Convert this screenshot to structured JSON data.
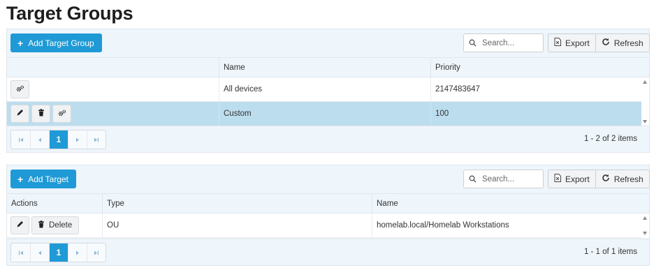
{
  "page": {
    "title": "Target Groups"
  },
  "groups_grid": {
    "add_button": "Add Target Group",
    "search_placeholder": "Search...",
    "export_label": "Export",
    "refresh_label": "Refresh",
    "columns": [
      "",
      "Name",
      "Priority"
    ],
    "rows": [
      {
        "name": "All devices",
        "priority": "2147483647"
      },
      {
        "name": "Custom",
        "priority": "100"
      }
    ],
    "pager": {
      "current_page": "1",
      "info": "1 - 2 of 2 items"
    }
  },
  "targets_grid": {
    "add_button": "Add Target",
    "search_placeholder": "Search...",
    "export_label": "Export",
    "refresh_label": "Refresh",
    "columns": [
      "Actions",
      "Type",
      "Name"
    ],
    "rows": [
      {
        "delete_label": "Delete",
        "type": "OU",
        "name": "homelab.local/Homelab Workstations"
      }
    ],
    "pager": {
      "current_page": "1",
      "info": "1 - 1 of 1 items"
    }
  },
  "colors": {
    "accent": "#1f9ad6",
    "selected_row": "#bcdded",
    "grid_bg": "#eef5fb"
  },
  "icons": [
    "plus-icon",
    "search-icon",
    "export-icon",
    "refresh-icon",
    "gears-icon",
    "pencil-icon",
    "trash-icon",
    "first-page-icon",
    "prev-page-icon",
    "next-page-icon",
    "last-page-icon"
  ]
}
